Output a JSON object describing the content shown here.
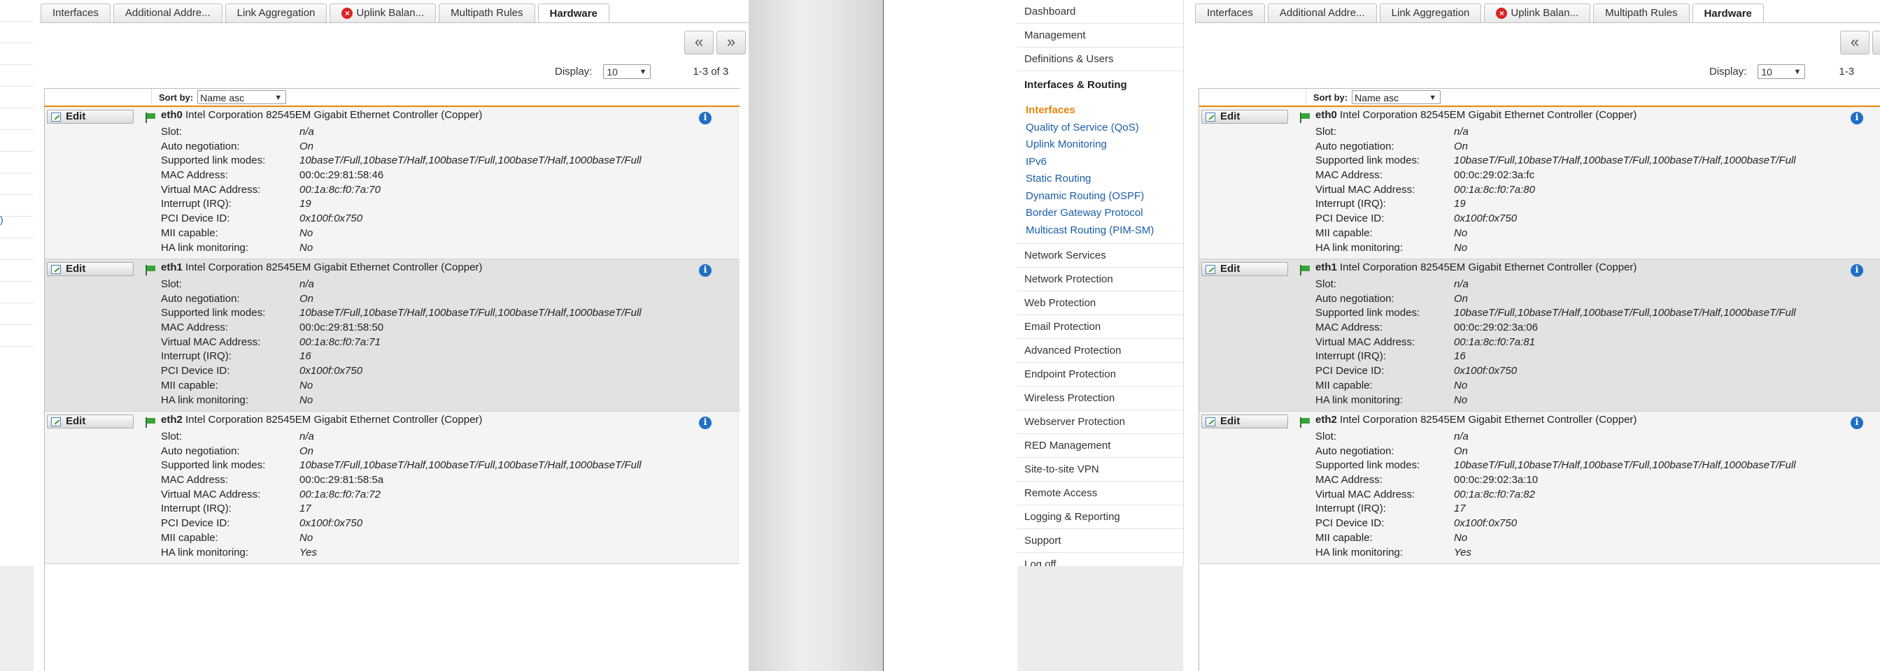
{
  "tabs": [
    {
      "label": "Interfaces",
      "active": false,
      "error": false
    },
    {
      "label": "Additional Addre...",
      "active": false,
      "error": false
    },
    {
      "label": "Link Aggregation",
      "active": false,
      "error": false
    },
    {
      "label": "Uplink Balan...",
      "active": false,
      "error": true
    },
    {
      "label": "Multipath Rules",
      "active": false,
      "error": false
    },
    {
      "label": "Hardware",
      "active": true,
      "error": false
    }
  ],
  "pager": {
    "prev": "«",
    "next": "»"
  },
  "display": {
    "label": "Display:",
    "value": "10",
    "count": "1-3 of 3",
    "count_partial": "1-3"
  },
  "sort": {
    "label": "Sort by:",
    "value": "Name asc"
  },
  "edit_label": "Edit",
  "prop_labels": {
    "slot": "Slot:",
    "autoneg": "Auto negotiation:",
    "modes": "Supported link modes:",
    "mac": "MAC Address:",
    "vmac": "Virtual MAC Address:",
    "irq": "Interrupt (IRQ):",
    "pci": "PCI Device ID:",
    "mii": "MII capable:",
    "ha": "HA link monitoring:"
  },
  "left_strip_fragment": ")",
  "nav": {
    "items_top": [
      "Dashboard",
      "Management",
      "Definitions & Users"
    ],
    "open_item": "Interfaces & Routing",
    "sub_items": [
      "Interfaces",
      "Quality of Service (QoS)",
      "Uplink Monitoring",
      "IPv6",
      "Static Routing",
      "Dynamic Routing (OSPF)",
      "Border Gateway Protocol",
      "Multicast Routing (PIM-SM)"
    ],
    "active_sub": "Interfaces",
    "items_bottom": [
      "Network Services",
      "Network Protection",
      "Web Protection",
      "Email Protection",
      "Advanced Protection",
      "Endpoint Protection",
      "Wireless Protection",
      "Webserver Protection",
      "RED Management",
      "Site-to-site VPN",
      "Remote Access",
      "Logging & Reporting",
      "Support",
      "Log off"
    ]
  },
  "left": {
    "interfaces": [
      {
        "name": "eth0",
        "desc": "Intel Corporation 82545EM Gigabit Ethernet Controller (Copper)",
        "slot": "n/a",
        "autoneg": "On",
        "modes": "10baseT/Full,10baseT/Half,100baseT/Full,100baseT/Half,1000baseT/Full",
        "mac": "00:0c:29:81:58:46",
        "vmac": "00:1a:8c:f0:7a:70",
        "irq": "19",
        "pci": "0x100f:0x750",
        "mii": "No",
        "ha": "No"
      },
      {
        "name": "eth1",
        "desc": "Intel Corporation 82545EM Gigabit Ethernet Controller (Copper)",
        "slot": "n/a",
        "autoneg": "On",
        "modes": "10baseT/Full,10baseT/Half,100baseT/Full,100baseT/Half,1000baseT/Full",
        "mac": "00:0c:29:81:58:50",
        "vmac": "00:1a:8c:f0:7a:71",
        "irq": "16",
        "pci": "0x100f:0x750",
        "mii": "No",
        "ha": "No"
      },
      {
        "name": "eth2",
        "desc": "Intel Corporation 82545EM Gigabit Ethernet Controller (Copper)",
        "slot": "n/a",
        "autoneg": "On",
        "modes": "10baseT/Full,10baseT/Half,100baseT/Full,100baseT/Half,1000baseT/Full",
        "mac": "00:0c:29:81:58:5a",
        "vmac": "00:1a:8c:f0:7a:72",
        "irq": "17",
        "pci": "0x100f:0x750",
        "mii": "No",
        "ha": "Yes"
      }
    ]
  },
  "right": {
    "interfaces": [
      {
        "name": "eth0",
        "desc": "Intel Corporation 82545EM Gigabit Ethernet Controller (Copper)",
        "slot": "n/a",
        "autoneg": "On",
        "modes": "10baseT/Full,10baseT/Half,100baseT/Full,100baseT/Half,1000baseT/Full",
        "mac": "00:0c:29:02:3a:fc",
        "vmac": "00:1a:8c:f0:7a:80",
        "irq": "19",
        "pci": "0x100f:0x750",
        "mii": "No",
        "ha": "No"
      },
      {
        "name": "eth1",
        "desc": "Intel Corporation 82545EM Gigabit Ethernet Controller (Copper)",
        "slot": "n/a",
        "autoneg": "On",
        "modes": "10baseT/Full,10baseT/Half,100baseT/Full,100baseT/Half,1000baseT/Full",
        "mac": "00:0c:29:02:3a:06",
        "vmac": "00:1a:8c:f0:7a:81",
        "irq": "16",
        "pci": "0x100f:0x750",
        "mii": "No",
        "ha": "No"
      },
      {
        "name": "eth2",
        "desc": "Intel Corporation 82545EM Gigabit Ethernet Controller (Copper)",
        "slot": "n/a",
        "autoneg": "On",
        "modes": "10baseT/Full,10baseT/Half,100baseT/Full,100baseT/Half,1000baseT/Full",
        "mac": "00:0c:29:02:3a:10",
        "vmac": "00:1a:8c:f0:7a:82",
        "irq": "17",
        "pci": "0x100f:0x750",
        "mii": "No",
        "ha": "Yes"
      }
    ]
  },
  "colors": {
    "accent": "#e8850b",
    "link": "#1a5ea8",
    "info": "#1f6fc5",
    "error": "#dd2222",
    "flag": "#39a339"
  }
}
